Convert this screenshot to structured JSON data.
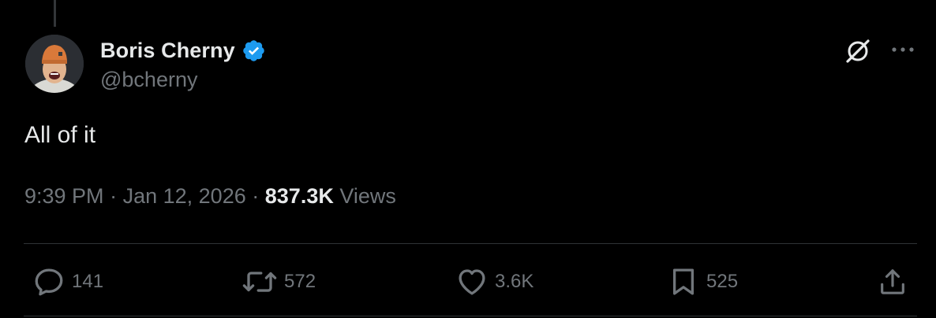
{
  "author": {
    "display_name": "Boris Cherny",
    "handle": "@bcherny",
    "verified": true,
    "verified_color": "#1d9bf0"
  },
  "tweet": {
    "text": "All of it",
    "time": "9:39 PM",
    "date": "Jan 12, 2026",
    "separator": "·",
    "views_count": "837.3K",
    "views_label": "Views"
  },
  "header_icons": [
    "grok-icon",
    "more-icon"
  ],
  "actions": {
    "reply": {
      "icon": "reply-icon",
      "count": "141"
    },
    "repost": {
      "icon": "repost-icon",
      "count": "572"
    },
    "like": {
      "icon": "heart-icon",
      "count": "3.6K"
    },
    "bookmark": {
      "icon": "bookmark-icon",
      "count": "525"
    },
    "share": {
      "icon": "share-icon"
    }
  },
  "colors": {
    "background": "#000000",
    "primary_text": "#e7e9ea",
    "secondary_text": "#71767b",
    "divider": "#2f3336"
  }
}
